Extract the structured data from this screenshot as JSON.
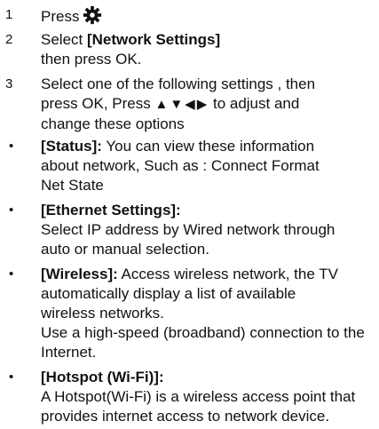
{
  "steps": [
    {
      "number": "1",
      "text": "Press",
      "icon": "gear-icon"
    },
    {
      "number": "2",
      "bold": "[Network Settings]",
      "prefix": "Select ",
      "line2": "then press OK."
    },
    {
      "number": "3",
      "line1": "Select one of the following settings , then",
      "line2_before": "press OK, Press ",
      "arrows": "▲▼◀▶",
      "line2_after": " to adjust and",
      "line3": "change these options"
    }
  ],
  "bullets": [
    {
      "marker": "•",
      "title": "[Status]:",
      "line1_rest": " You can view these information",
      "line2": "about network, Such as : Connect Format",
      "line3": "Net State"
    },
    {
      "marker": "•",
      "title": "[Ethernet Settings]:",
      "line2": "Select IP address by Wired network through",
      "line3": "auto or manual selection."
    },
    {
      "marker": "•",
      "title": "[Wireless]:",
      "line1_rest": " Access wireless network, the TV",
      "line2": "automatically display a list of available",
      "line3": "wireless networks.",
      "line4": "Use a high-speed (broadband) connection to the",
      "line5": "Internet."
    },
    {
      "marker": "•",
      "title": "[Hotspot (Wi-Fi)]:",
      "line2": "A Hotspot(Wi-Fi) is a wireless access point that",
      "line3": "provides internet access to network device."
    }
  ]
}
